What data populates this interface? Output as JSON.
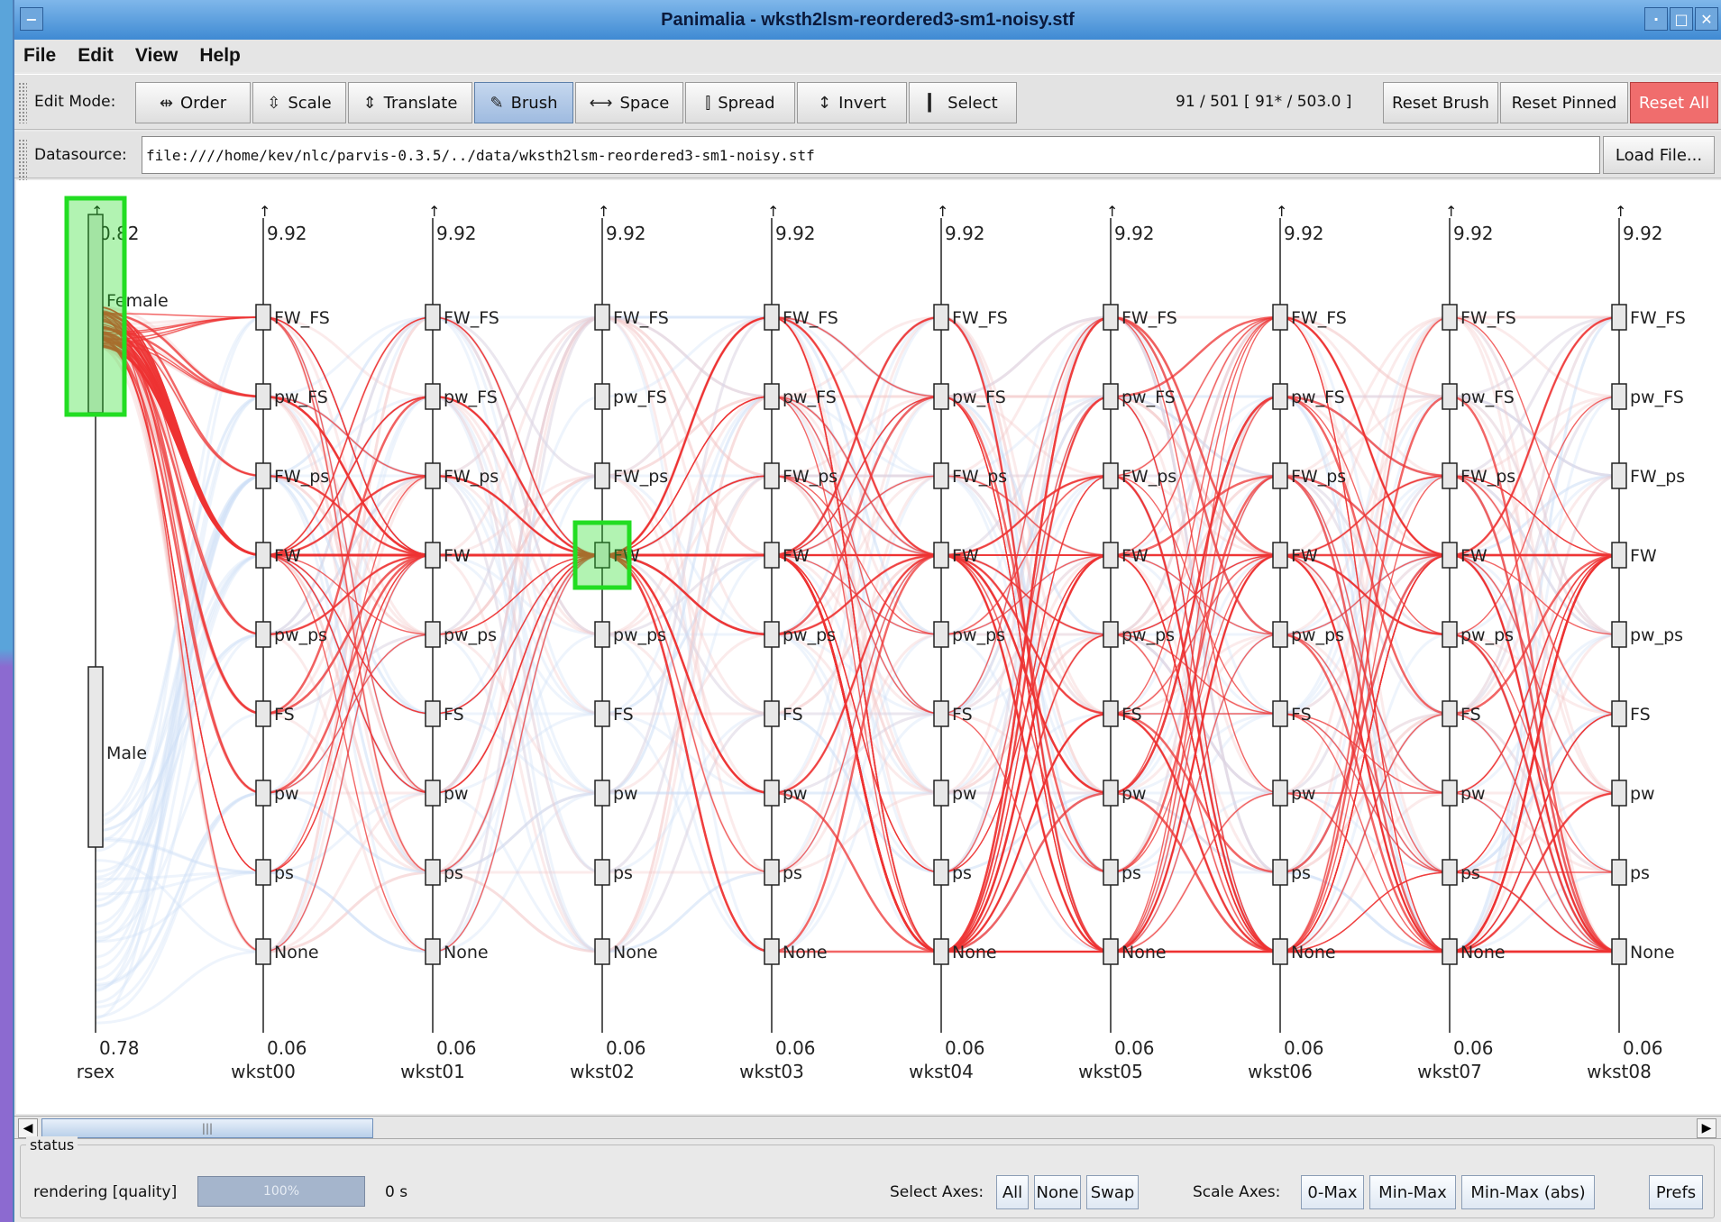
{
  "window": {
    "title": "Panimalia - wksth2lsm-reordered3-sm1-noisy.stf"
  },
  "menu": [
    "File",
    "Edit",
    "View",
    "Help"
  ],
  "toolbar": {
    "edit_mode_label": "Edit Mode:",
    "modes": [
      {
        "label": "Order",
        "icon": "order-icon"
      },
      {
        "label": "Scale",
        "icon": "scale-icon"
      },
      {
        "label": "Translate",
        "icon": "translate-icon"
      },
      {
        "label": "Brush",
        "icon": "brush-icon",
        "active": true
      },
      {
        "label": "Space",
        "icon": "space-icon"
      },
      {
        "label": "Spread",
        "icon": "spread-icon"
      },
      {
        "label": "Invert",
        "icon": "invert-icon"
      },
      {
        "label": "Select",
        "icon": "select-icon"
      }
    ],
    "count_text": "91 / 501  [ 91* / 503.0 ]",
    "reset_brush": "Reset Brush",
    "reset_pinned": "Reset Pinned",
    "reset_all": "Reset All"
  },
  "datasource": {
    "label": "Datasource:",
    "value": "file:////home/kev/nlc/parvis-0.3.5/../data/wksth2lsm-reordered3-sm1-noisy.stf",
    "load_button": "Load File..."
  },
  "axes": {
    "first": {
      "name": "rsex",
      "max": "0.82",
      "min": "0.78",
      "categories": [
        "Female",
        "Male"
      ]
    },
    "others_max": "9.92",
    "others_min": "0.06",
    "names": [
      "wkst00",
      "wkst01",
      "wkst02",
      "wkst03",
      "wkst04",
      "wkst05",
      "wkst06",
      "wkst07",
      "wkst08"
    ],
    "categories": [
      "FW_FS",
      "pw_FS",
      "FW_ps",
      "FW",
      "pw_ps",
      "FS",
      "pw",
      "ps",
      "None"
    ],
    "brushed_rsex": "Female",
    "brushed_wkst02": "FW",
    "colors": {
      "brushed": "#ee3333",
      "context": "#f4c6c6",
      "unbrushed": "#cfdff5",
      "brush_box": "#22dd22"
    }
  },
  "status": {
    "legend": "status",
    "rendering_label": "rendering [quality]",
    "progress_text": "100%",
    "progress": 1.0,
    "time": "0 s",
    "select_axes_label": "Select Axes:",
    "select_axes_buttons": [
      "All",
      "None",
      "Swap"
    ],
    "scale_axes_label": "Scale Axes:",
    "scale_axes_buttons": [
      "0-Max",
      "Min-Max",
      "Min-Max (abs)"
    ],
    "prefs": "Prefs"
  }
}
